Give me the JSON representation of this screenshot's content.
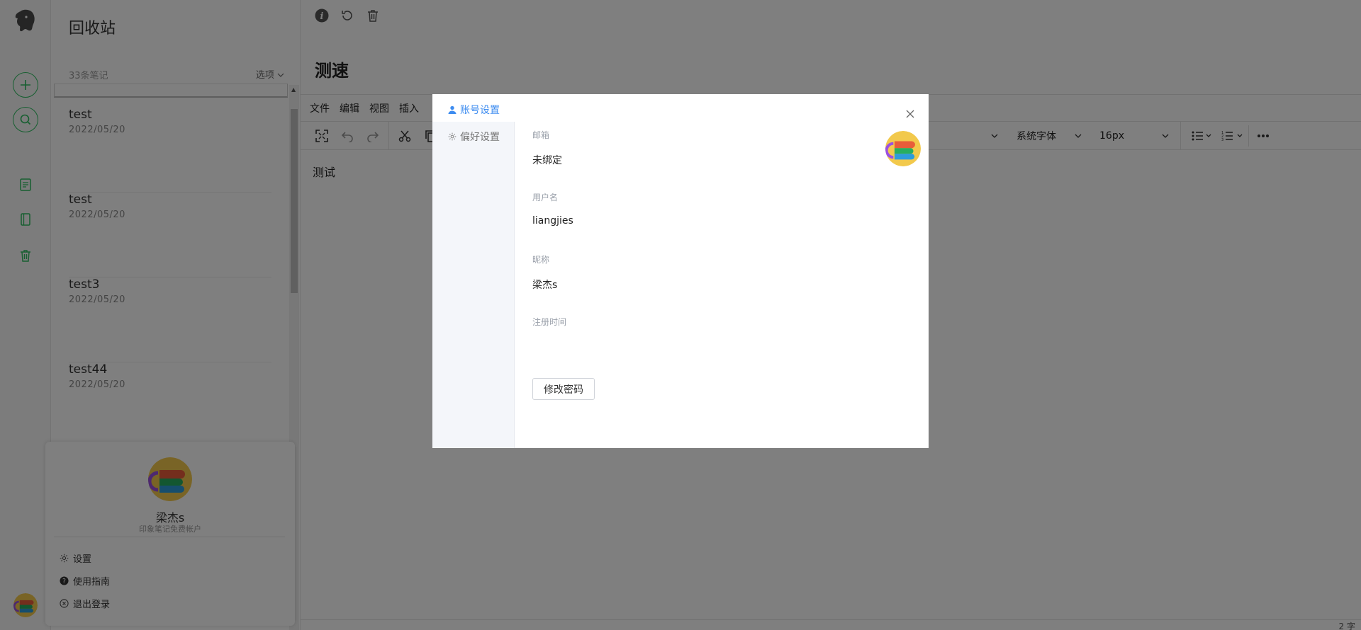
{
  "notebook": {
    "title": "回收站",
    "count_label": "33条笔记",
    "options_label": "选项"
  },
  "notes": [
    {
      "title": "test",
      "date": "2022/05/20"
    },
    {
      "title": "test",
      "date": "2022/05/20"
    },
    {
      "title": "test3",
      "date": "2022/05/20"
    },
    {
      "title": "test44",
      "date": "2022/05/20"
    }
  ],
  "account_menu": {
    "name": "梁杰s",
    "subtitle": "印象笔记免费帐户",
    "items": [
      {
        "label": "设置",
        "icon": "gear-icon"
      },
      {
        "label": "使用指南",
        "icon": "help-icon"
      },
      {
        "label": "退出登录",
        "icon": "logout-icon"
      }
    ]
  },
  "editor": {
    "title": "测速",
    "menu": [
      "文件",
      "编辑",
      "视图",
      "插入"
    ],
    "font_family": "系统字体",
    "font_size": "16px",
    "body_text": "测试",
    "word_count": "2 字"
  },
  "modal": {
    "tabs": {
      "account": "账号设置",
      "preferences": "偏好设置"
    },
    "fields": {
      "email_label": "邮箱",
      "email_value": "未绑定",
      "username_label": "用户名",
      "username_value": "liangjies",
      "nickname_label": "昵称",
      "nickname_value": "梁杰s",
      "register_label": "注册时间",
      "register_value": ""
    },
    "change_password": "修改密码"
  },
  "colors": {
    "brand_green": "#2dbe60",
    "accent_blue": "#3d8cf0"
  }
}
